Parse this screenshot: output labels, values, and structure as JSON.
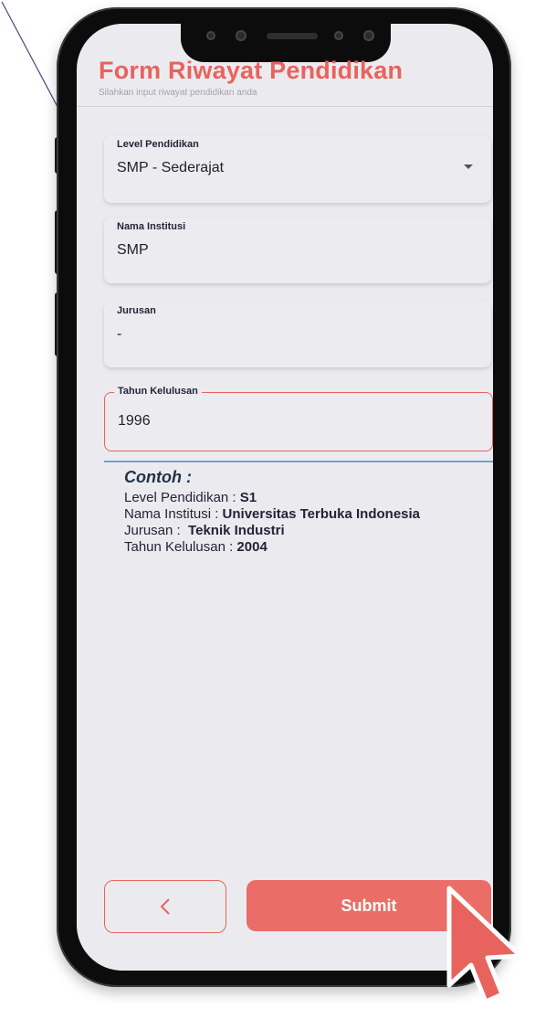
{
  "header": {
    "title": "Form Riwayat Pendidikan",
    "subtitle": "Silahkan input riwayat pendidikan anda"
  },
  "form": {
    "level": {
      "label": "Level Pendidikan",
      "value": "SMP - Sederajat"
    },
    "institusi": {
      "label": "Nama Institusi",
      "value": "SMP"
    },
    "jurusan": {
      "label": "Jurusan",
      "value": "-"
    },
    "tahun": {
      "label": "Tahun Kelulusan",
      "value": "1996"
    }
  },
  "example": {
    "heading": "Contoh :",
    "rows": [
      {
        "label": "Level Pendidikan : ",
        "value": "S1"
      },
      {
        "label": "Nama Institusi : ",
        "value": "Universitas Terbuka Indonesia"
      },
      {
        "label": "Jurusan :  ",
        "value": "Teknik Industri"
      },
      {
        "label": "Tahun Kelulusan : ",
        "value": "2004"
      }
    ]
  },
  "actions": {
    "back_icon": "chevron-left-icon",
    "submit_label": "Submit"
  },
  "colors": {
    "accent": "#e8635e",
    "button": "#ea6e67",
    "screen_bg": "#ebebef",
    "divider": "#7d9fc3"
  }
}
